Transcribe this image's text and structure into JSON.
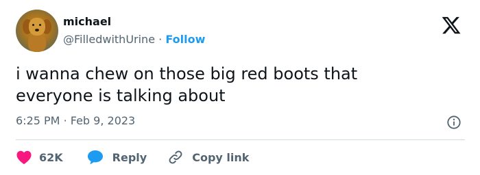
{
  "author": {
    "name": "michael",
    "handle": "@FilledwithUrine",
    "separator": "·",
    "follow_label": "Follow"
  },
  "tweet": {
    "text_line1": "i wanna chew on those big red boots that",
    "text_line2": "everyone is talking about",
    "time": "6:25 PM",
    "date": "Feb 9, 2023",
    "meta_separator": "·"
  },
  "actions": {
    "likes_count": "62K",
    "reply_label": "Reply",
    "copy_link_label": "Copy link"
  },
  "icons": {
    "logo": "x-logo-icon",
    "info": "info-icon",
    "like": "heart-icon",
    "reply": "speech-bubble-icon",
    "copy": "link-icon"
  },
  "colors": {
    "accent": "#1d9bf0",
    "heart": "#f91880",
    "secondary_text": "#536471",
    "primary_text": "#0f1419"
  }
}
